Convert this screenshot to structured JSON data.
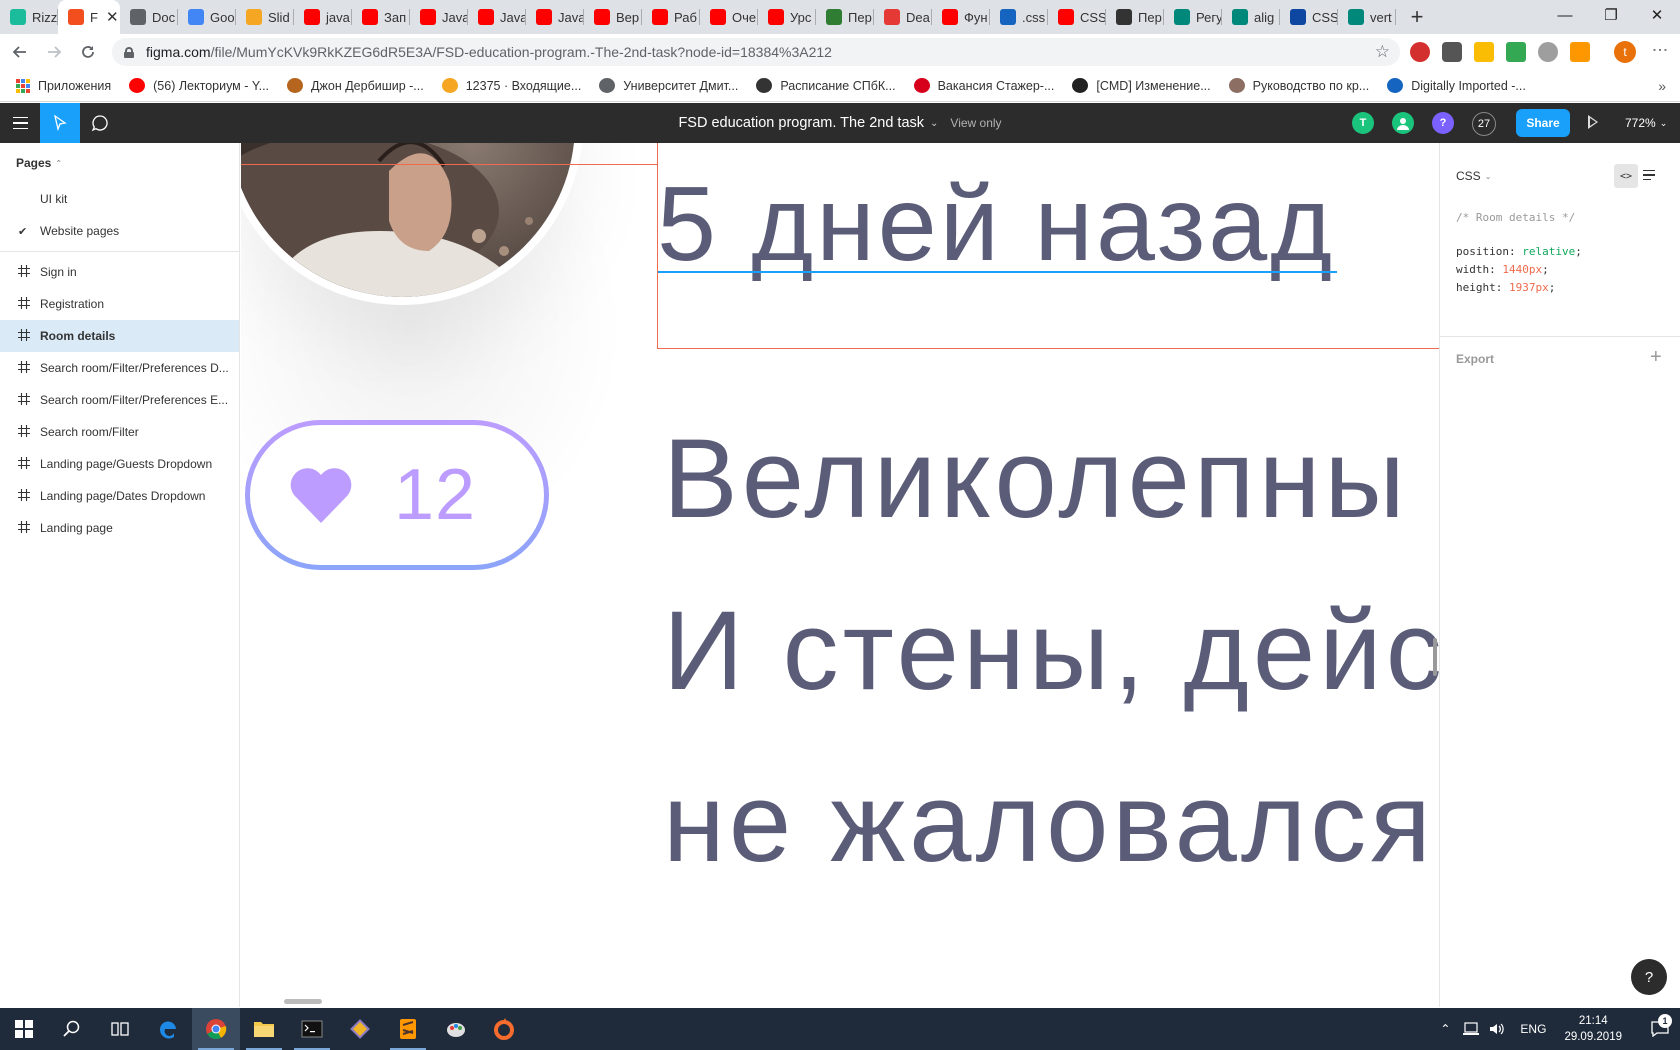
{
  "browser": {
    "tabs": [
      {
        "label": "Rizz",
        "color": "#1bbc9b"
      },
      {
        "label": "F",
        "color": "#f24e1e",
        "active": true
      },
      {
        "label": "Doc",
        "color": "#5f6368"
      },
      {
        "label": "Goo",
        "color": "#4285f4"
      },
      {
        "label": "Slid",
        "color": "#f5a623"
      },
      {
        "label": "java",
        "color": "#ff0000"
      },
      {
        "label": "Зап",
        "color": "#ff0000"
      },
      {
        "label": "Java",
        "color": "#ff0000"
      },
      {
        "label": "Java",
        "color": "#ff0000"
      },
      {
        "label": "Java",
        "color": "#ff0000"
      },
      {
        "label": "Вер",
        "color": "#ff0000"
      },
      {
        "label": "Раб",
        "color": "#ff0000"
      },
      {
        "label": "Оче",
        "color": "#ff0000"
      },
      {
        "label": "Урс",
        "color": "#ff0000"
      },
      {
        "label": "Пер",
        "color": "#2e7d32"
      },
      {
        "label": "Dea",
        "color": "#e53935"
      },
      {
        "label": "Фун",
        "color": "#ff0000"
      },
      {
        "label": ".css",
        "color": "#1565c0"
      },
      {
        "label": "CSS",
        "color": "#ff0000"
      },
      {
        "label": "Пер",
        "color": "#333333"
      },
      {
        "label": "Регу",
        "color": "#00897b"
      },
      {
        "label": "alig",
        "color": "#00897b"
      },
      {
        "label": "CSS",
        "color": "#0d47a1"
      },
      {
        "label": "vert",
        "color": "#00897b"
      }
    ],
    "active_tab_close": "✕",
    "new_tab": "+",
    "window_controls": {
      "minimize": "—",
      "restore": "❐",
      "close": "✕"
    },
    "url_host": "figma.com",
    "url_path": "/file/MumYcKVk9RkKZEG6dR5E3A/FSD-education-program.-The-2nd-task?node-id=18384%3A212",
    "profile_initial": "t",
    "bookmarks": [
      {
        "label": "Приложения",
        "color": "apps"
      },
      {
        "label": "(56) Лекториум - Y...",
        "color": "#ff0000"
      },
      {
        "label": "Джон Дербишир -...",
        "color": "#b5651d"
      },
      {
        "label": "12375 · Входящие...",
        "color": "#f5a623"
      },
      {
        "label": "Университет Дмит...",
        "color": "#5f6368"
      },
      {
        "label": "Расписание СПбК...",
        "color": "#333333"
      },
      {
        "label": "Вакансия Стажер-...",
        "color": "#d6001c"
      },
      {
        "label": "[CMD] Изменение...",
        "color": "#222222"
      },
      {
        "label": "Руководство по кр...",
        "color": "#8d6e63"
      },
      {
        "label": "Digitally Imported -...",
        "color": "#1565c0"
      }
    ],
    "bookmarks_more": "»"
  },
  "figma": {
    "file_title": "FSD education program. The 2nd task",
    "view_mode": "View only",
    "avatars": [
      {
        "initial": "T",
        "color": "#1bc47d"
      },
      {
        "initial": "",
        "color": "#1bc47d"
      },
      {
        "initial": "?",
        "color": "#7b61ff"
      }
    ],
    "viewer_count": "27",
    "share_label": "Share",
    "zoom": "772%",
    "pages_title": "Pages",
    "pages": [
      {
        "label": "UI kit",
        "checked": false
      },
      {
        "label": "Website pages",
        "checked": true
      }
    ],
    "frames": [
      {
        "label": "Sign in",
        "selected": false
      },
      {
        "label": "Registration",
        "selected": false
      },
      {
        "label": "Room details",
        "selected": true
      },
      {
        "label": "Search room/Filter/Preferences D...",
        "selected": false
      },
      {
        "label": "Search room/Filter/Preferences E...",
        "selected": false
      },
      {
        "label": "Search room/Filter",
        "selected": false
      },
      {
        "label": "Landing page/Guests Dropdown",
        "selected": false
      },
      {
        "label": "Landing page/Dates Dropdown",
        "selected": false
      },
      {
        "label": "Landing page",
        "selected": false
      }
    ],
    "canvas": {
      "date_text": "5 дней назад",
      "likes_count": "12",
      "review_lines": [
        "Великолепны",
        "И стены, дейс",
        "не жаловался"
      ],
      "text_color": "#5b5d78",
      "like_color": "#bc9cff"
    },
    "inspect": {
      "format": "CSS",
      "code_comment": "/* Room details */",
      "properties": [
        {
          "key": "position",
          "value": "relative",
          "kind": "keyword"
        },
        {
          "key": "width",
          "value": "1440px",
          "kind": "number"
        },
        {
          "key": "height",
          "value": "1937px",
          "kind": "number"
        }
      ],
      "export_label": "Export",
      "export_add": "+",
      "help": "?"
    }
  },
  "taskbar": {
    "lang": "ENG",
    "time": "21:14",
    "date": "29.09.2019",
    "notification_count": "1"
  }
}
